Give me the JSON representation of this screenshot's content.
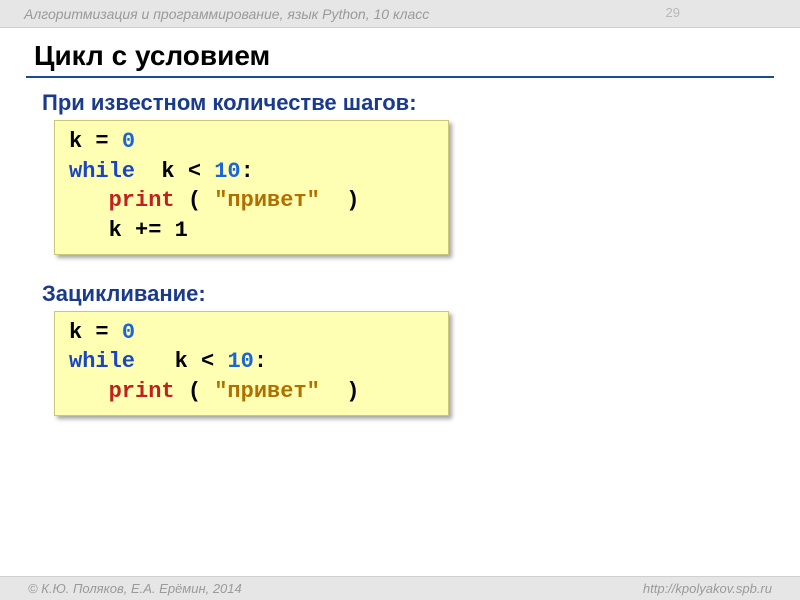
{
  "header": {
    "text": "Алгоритмизация и программирование, язык Python, 10 класс",
    "page_number": "29"
  },
  "title": "Цикл с условием",
  "section1": {
    "label": "При известном количестве шагов:",
    "code": {
      "l1_a": "k = ",
      "l1_num": "0",
      "l2_kw": "while",
      "l2_mid": "  k < ",
      "l2_num": "10",
      "l2_end": ":",
      "l3_pad": "   ",
      "l3_fn": "print",
      "l3_open": " ( ",
      "l3_str": "\"привет\"",
      "l3_close": "  )",
      "l4": "   k += 1"
    }
  },
  "section2": {
    "label": "Зацикливание:",
    "code": {
      "l1_a": "k = ",
      "l1_num": "0",
      "l2_kw": "while",
      "l2_mid": "   k < ",
      "l2_num": "10",
      "l2_end": ":",
      "l3_pad": "   ",
      "l3_fn": "print",
      "l3_open": " ( ",
      "l3_str": "\"привет\"",
      "l3_close": "  )"
    }
  },
  "footer": {
    "left": "© К.Ю. Поляков, Е.А. Ерёмин, 2014",
    "right": "http://kpolyakov.spb.ru"
  }
}
